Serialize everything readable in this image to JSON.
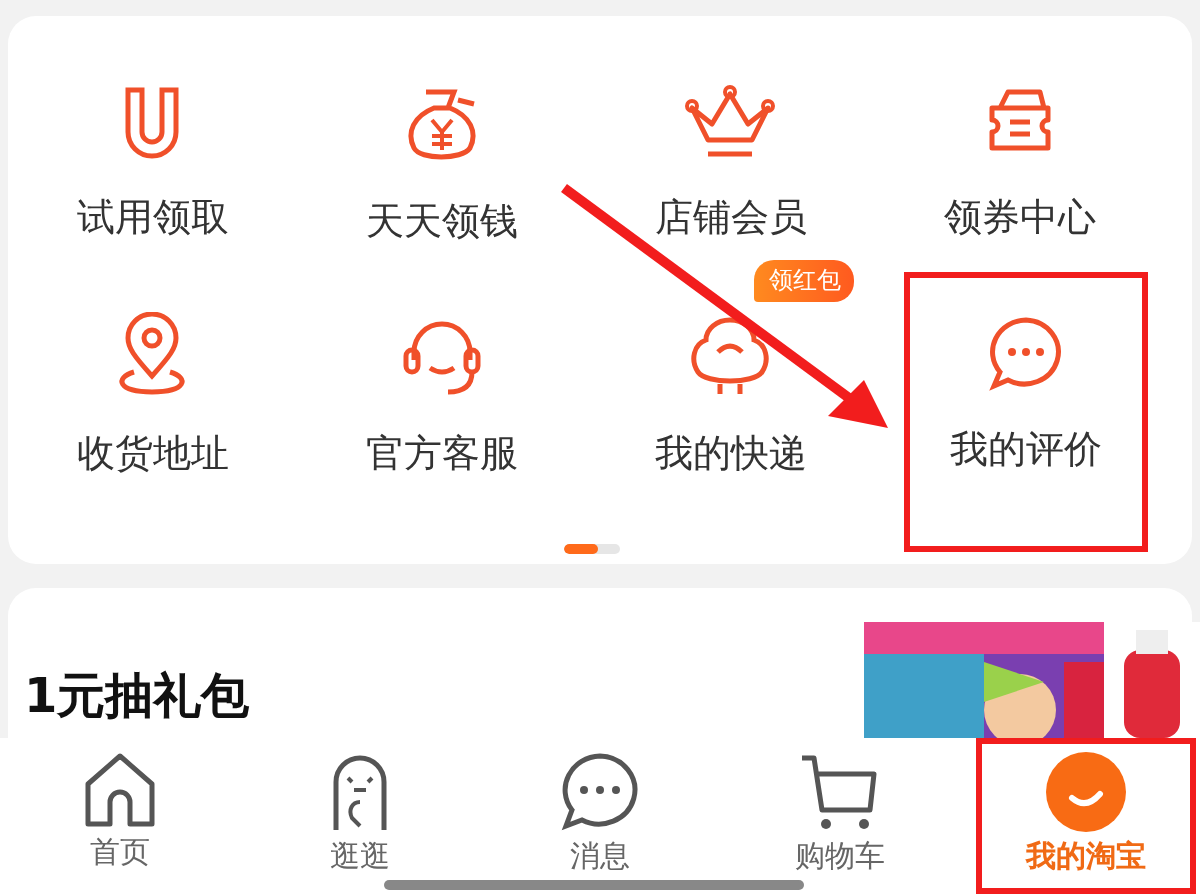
{
  "services": [
    {
      "label": "试用领取",
      "highlighted": false
    },
    {
      "label": "天天领钱",
      "highlighted": false
    },
    {
      "label": "店铺会员",
      "highlighted": false
    },
    {
      "label": "领券中心",
      "highlighted": false
    },
    {
      "label": "收货地址",
      "highlighted": false
    },
    {
      "label": "官方客服",
      "highlighted": false
    },
    {
      "label": "我的快递",
      "highlighted": false,
      "badge": "领红包"
    },
    {
      "label": "我的评价",
      "highlighted": true
    }
  ],
  "pager": {
    "level": 0.6
  },
  "promo": {
    "title": "1元抽礼包"
  },
  "tabs": [
    {
      "label": "首页",
      "selected": false,
      "highlighted": false
    },
    {
      "label": "逛逛",
      "selected": false,
      "highlighted": false
    },
    {
      "label": "消息",
      "selected": false,
      "highlighted": false
    },
    {
      "label": "购物车",
      "selected": false,
      "highlighted": false
    },
    {
      "label": "我的淘宝",
      "selected": true,
      "highlighted": true
    }
  ]
}
